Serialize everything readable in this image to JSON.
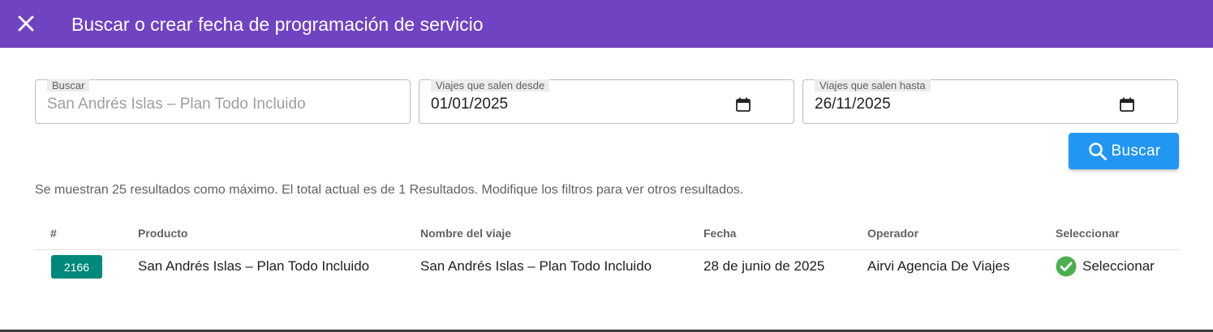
{
  "header": {
    "title": "Buscar o crear fecha de programación de servicio",
    "close_icon": "close-icon",
    "background_color": "#7043c2"
  },
  "filters": {
    "search": {
      "label": "Buscar",
      "placeholder": "San Andrés Islas – Plan Todo Incluido",
      "value": ""
    },
    "from": {
      "label": "Viajes que salen desde",
      "value": "01/01/2025",
      "icon": "calendar-icon"
    },
    "to": {
      "label": "Viajes que salen hasta",
      "value": "26/11/2025",
      "icon": "calendar-icon"
    }
  },
  "search_button": {
    "label": "Buscar",
    "icon": "search-icon",
    "color": "#2196f3"
  },
  "info_text": "Se muestran 25 resultados como máximo. El total actual es de 1 Resultados. Modifique los filtros para ver otros resultados.",
  "table": {
    "columns": [
      "#",
      "Producto",
      "Nombre del viaje",
      "Fecha",
      "Operador",
      "Seleccionar"
    ],
    "rows": [
      {
        "id": "2166",
        "producto": "San Andrés Islas – Plan Todo Incluido",
        "nombre_viaje": "San Andrés Islas – Plan Todo Incluido",
        "fecha": "28 de junio de 2025",
        "operador": "Airvi Agencia De Viajes",
        "seleccionar": "Seleccionar",
        "select_icon": "check-circle-icon"
      }
    ],
    "badge_color": "#00897b",
    "check_color": "#4caf50"
  }
}
